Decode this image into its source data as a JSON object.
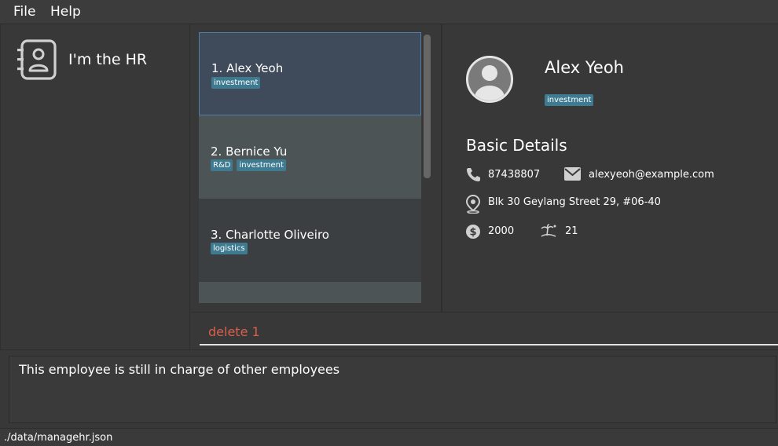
{
  "menu": {
    "file": "File",
    "help": "Help"
  },
  "app": {
    "title": "I'm the HR"
  },
  "list": {
    "items": [
      {
        "name": "1.  Alex Yeoh",
        "tags": [
          "investment"
        ]
      },
      {
        "name": "2.  Bernice Yu",
        "tags": [
          "R&D",
          "investment"
        ]
      },
      {
        "name": "3.  Charlotte Oliveiro",
        "tags": [
          "logistics"
        ]
      }
    ]
  },
  "detail": {
    "name": "Alex Yeoh",
    "tag": "investment",
    "heading": "Basic Details",
    "phone": "87438807",
    "email": "alexyeoh@example.com",
    "address": "Blk 30 Geylang Street 29, #06-40",
    "salary": "2000",
    "leave": "21"
  },
  "command": {
    "text": "delete 1"
  },
  "result": {
    "text": "This employee is still in charge of other employees"
  },
  "status": {
    "path": "./data/managehr.json"
  },
  "colors": {
    "accent_tag": "#3e7b91",
    "command_error": "#d9604c",
    "selection": "#3f4a5a"
  },
  "icons": [
    "address-book-icon",
    "avatar-icon",
    "phone-icon",
    "mail-icon",
    "location-icon",
    "dollar-icon",
    "beach-icon"
  ]
}
